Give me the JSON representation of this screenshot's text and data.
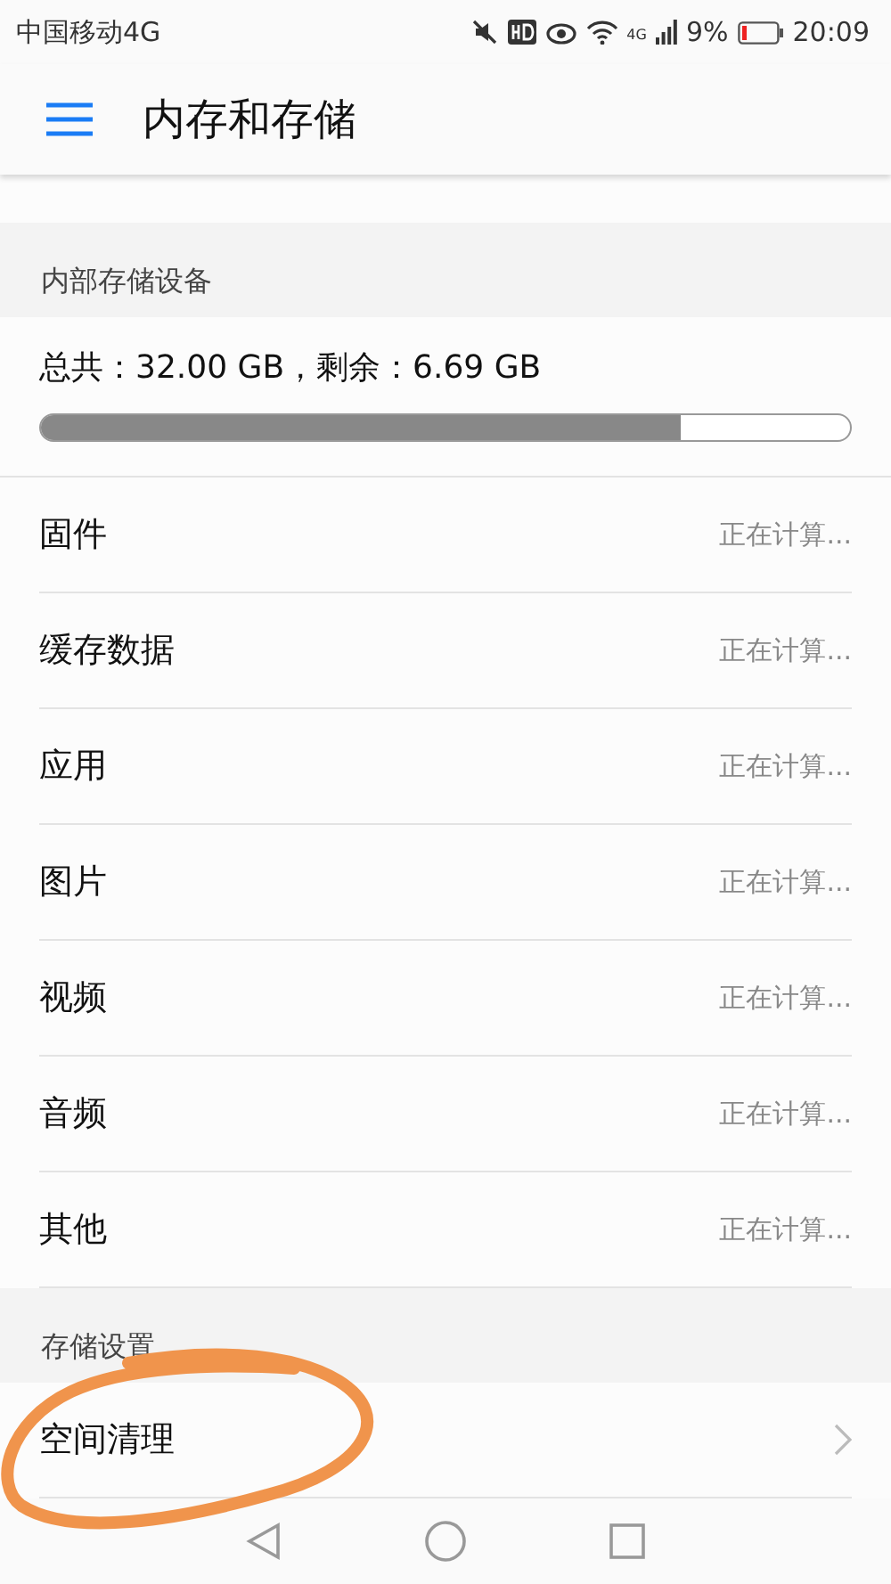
{
  "status_bar": {
    "carrier": "中国移动4G",
    "network": "4G",
    "battery": "9%",
    "time": "20:09"
  },
  "header": {
    "title": "内存和存储"
  },
  "sections": [
    {
      "title": "内部存储设备",
      "summary": "总共：32.00 GB，剩余：6.69 GB",
      "level": 0.79,
      "rows": [
        {
          "label": "固件",
          "value": "正在计算..."
        },
        {
          "label": "缓存数据",
          "value": "正在计算..."
        },
        {
          "label": "应用",
          "value": "正在计算..."
        },
        {
          "label": "图片",
          "value": "正在计算..."
        },
        {
          "label": "视频",
          "value": "正在计算..."
        },
        {
          "label": "音频",
          "value": "正在计算..."
        },
        {
          "label": "其他",
          "value": "正在计算..."
        }
      ]
    },
    {
      "title": "存储设置",
      "rows": [
        {
          "label": "空间清理"
        }
      ]
    }
  ]
}
